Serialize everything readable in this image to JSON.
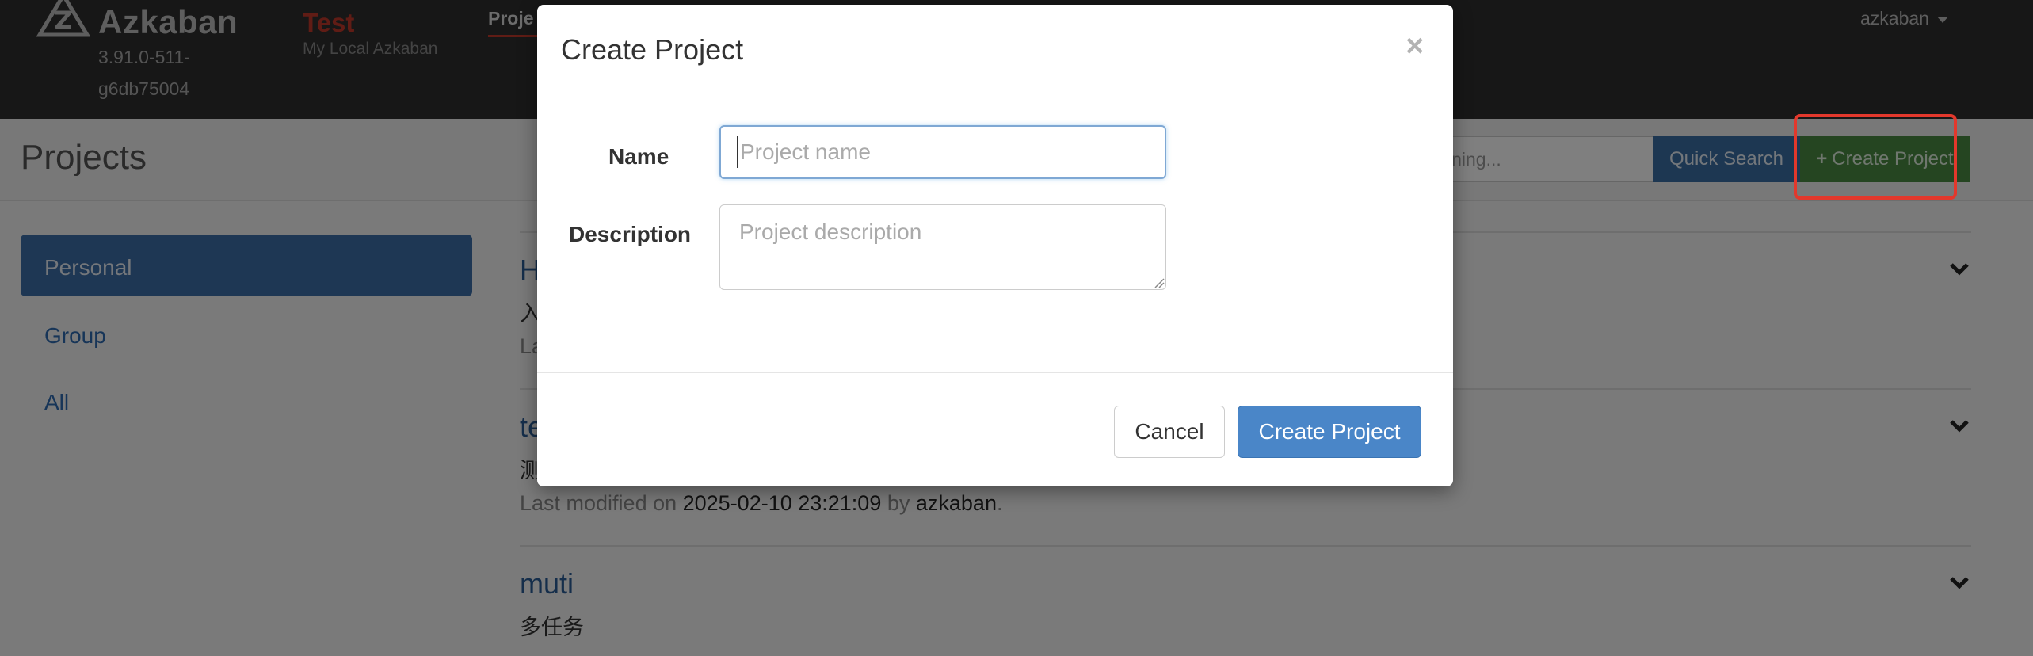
{
  "navbar": {
    "brand_name": "Azkaban",
    "brand_version": "3.91.0-511-g6db75004",
    "env_name": "Test",
    "env_subtitle": "My Local Azkaban",
    "active_tab": "Proje",
    "user": "azkaban",
    "icons": {
      "logo": "azkaban-logo-icon",
      "user_caret": "caret-down-icon"
    }
  },
  "page_header": {
    "title": "Projects",
    "search_value": "ntaining...",
    "quick_search_label": "Quick Search",
    "create_project_label": "Create Project",
    "create_project_icon": "plus-icon"
  },
  "sidebar": {
    "items": [
      {
        "label": "Personal",
        "active": true
      },
      {
        "label": "Group",
        "active": false
      },
      {
        "label": "All",
        "active": false
      }
    ]
  },
  "projects": [
    {
      "name": "H",
      "description": "入",
      "meta_prefix": "La",
      "modified": "",
      "by": "",
      "user": ""
    },
    {
      "name": "te",
      "description": "测",
      "meta_prefix": "Last modified on ",
      "modified": "2025-02-10 23:21:09",
      "by": " by ",
      "user": "azkaban",
      "suffix": "."
    },
    {
      "name": "muti",
      "description": "多任务",
      "meta_prefix": "",
      "modified": "",
      "by": "",
      "user": ""
    }
  ],
  "modal": {
    "title": "Create Project",
    "close_label": "×",
    "name_label": "Name",
    "name_placeholder": "Project name",
    "name_value": "",
    "description_label": "Description",
    "description_placeholder": "Project description",
    "cancel_label": "Cancel",
    "submit_label": "Create Project"
  },
  "colors": {
    "navbar_bg": "#2e2e2e",
    "env_accent": "#c0392b",
    "primary": "#4a86c8",
    "success": "#4a8a43",
    "highlight": "#e3382c"
  }
}
